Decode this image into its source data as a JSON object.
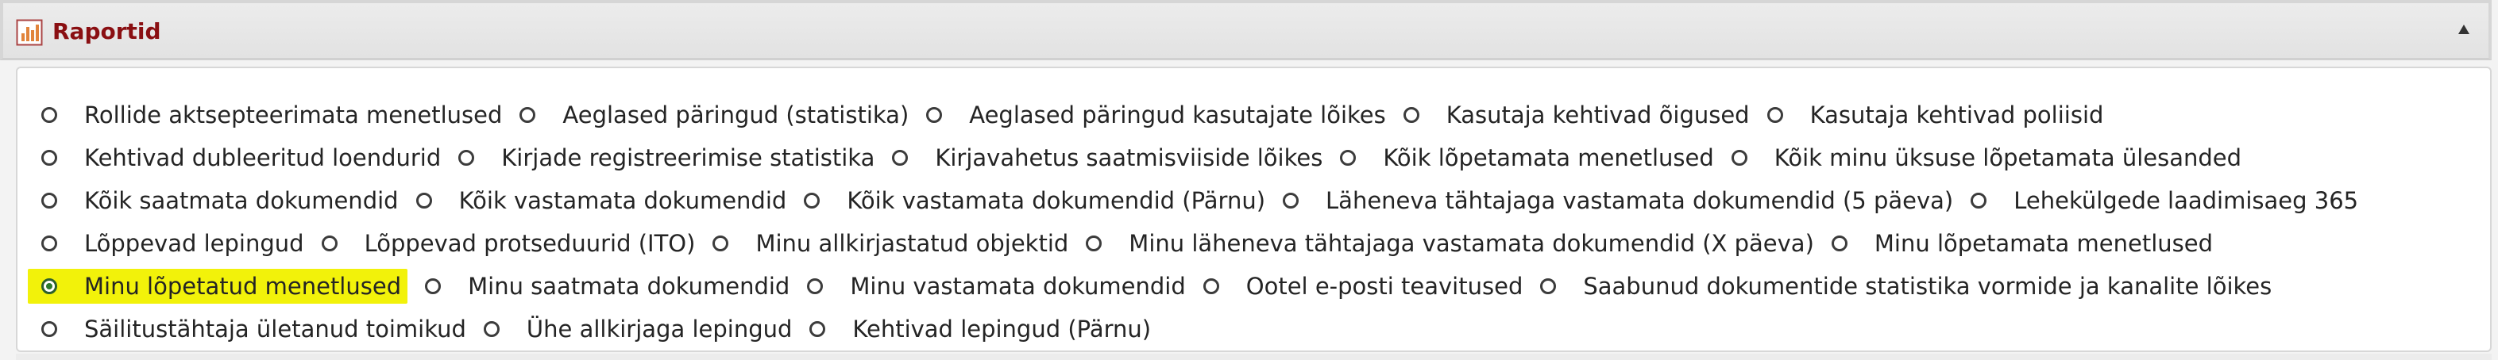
{
  "panel": {
    "title": "Raportid",
    "colors": {
      "title": "#8a0f12",
      "selected_highlight": "#f2f20a"
    },
    "icons": {
      "report": "bar-chart-icon",
      "collapse": "triangle-up-icon"
    }
  },
  "reports": {
    "selected": "Minu lõpetatud menetlused",
    "rows": [
      [
        "Rollide aktsepteerimata menetlused",
        "Aeglased päringud (statistika)",
        "Aeglased päringud kasutajate lõikes",
        "Kasutaja kehtivad õigused",
        "Kasutaja kehtivad poliisid"
      ],
      [
        "Kehtivad dubleeritud loendurid",
        "Kirjade registreerimise statistika",
        "Kirjavahetus saatmisviiside lõikes",
        "Kõik lõpetamata menetlused",
        "Kõik minu üksuse lõpetamata ülesanded"
      ],
      [
        "Kõik saatmata dokumendid",
        "Kõik vastamata dokumendid",
        "Kõik vastamata dokumendid (Pärnu)",
        "Läheneva tähtajaga vastamata dokumendid (5 päeva)",
        "Lehekülgede laadimisaeg 365"
      ],
      [
        "Lõppevad lepingud",
        "Lõppevad protseduurid (ITO)",
        "Minu allkirjastatud objektid",
        "Minu läheneva tähtajaga vastamata dokumendid (X päeva)",
        "Minu lõpetamata menetlused"
      ],
      [
        "Minu lõpetatud menetlused",
        "Minu saatmata dokumendid",
        "Minu vastamata dokumendid",
        "Ootel e-posti teavitused",
        "Saabunud dokumentide statistika vormide ja kanalite lõikes"
      ],
      [
        "Säilitustähtaja ületanud toimikud",
        "Ühe allkirjaga lepingud",
        "Kehtivad lepingud (Pärnu)"
      ]
    ]
  }
}
